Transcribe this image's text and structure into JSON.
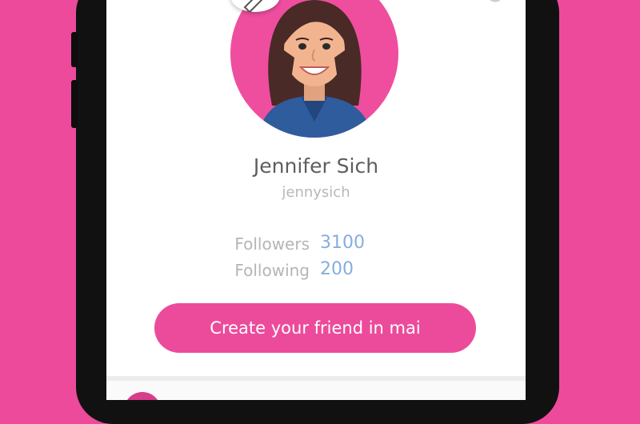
{
  "profile": {
    "name": "Jennifer Sich",
    "username": "jennysich",
    "avatar_bg": "#ef4e9f"
  },
  "stats": [
    {
      "label": "Followers",
      "value": "3100"
    },
    {
      "label": "Following",
      "value": "200"
    }
  ],
  "cta": {
    "label": "Create your friend in mai"
  },
  "colors": {
    "background": "#ee4a9c",
    "accent": "#ec4b9b",
    "stat_value": "#86aede"
  },
  "icons": {
    "edit": "pencil-icon",
    "settings": "gear-icon"
  }
}
